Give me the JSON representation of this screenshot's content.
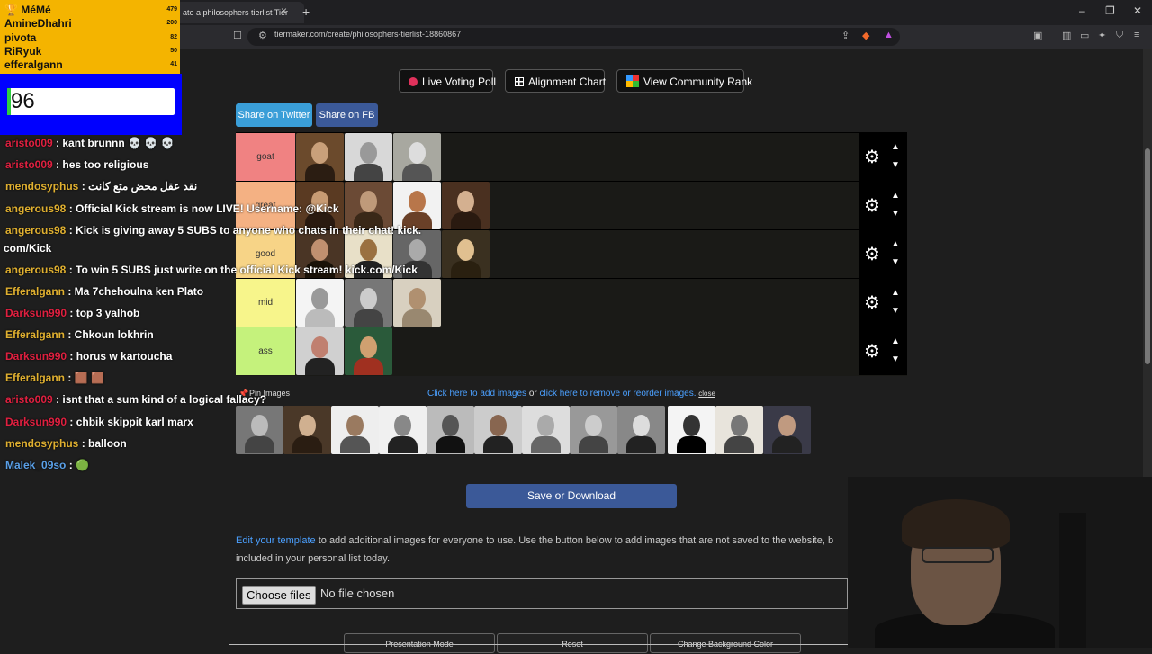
{
  "browser": {
    "tab_title": "ate a philosophers tierlist Tier",
    "tab_close": "×",
    "new_tab": "+",
    "url": "tiermaker.com/create/philosophers-tierlist-18860867",
    "window_controls": [
      "–",
      "❐",
      "✕"
    ]
  },
  "top_buttons": [
    {
      "label": "Live Voting Poll",
      "icon": "record-dot-icon"
    },
    {
      "label": "Alignment Chart",
      "icon": "grid-icon"
    },
    {
      "label": "View Community Rank",
      "icon": "mosaic-icon"
    }
  ],
  "share": {
    "twitter": "Share on Twitter",
    "fb": "Share on FB"
  },
  "tiers": [
    {
      "label": "goat",
      "color": "#f08282",
      "count": 3
    },
    {
      "label": "great",
      "color": "#f4b183",
      "count": 4
    },
    {
      "label": "good",
      "color": "#f7d487",
      "count": 4
    },
    {
      "label": "mid",
      "color": "#f7f58b",
      "count": 3
    },
    {
      "label": "ass",
      "color": "#c5f27c",
      "count": 2
    }
  ],
  "pin_images": "Pin Images",
  "image_links": {
    "add": "Click here to add images",
    "or": "or",
    "remove": "click here to remove or reorder images.",
    "close": "close"
  },
  "pool_count": 12,
  "save_button": "Save or Download",
  "help": {
    "link": "Edit your template",
    "text": " to add additional images for everyone to use. Use the button below to add images that are not saved to the website, b",
    "line2": "included in your personal list today."
  },
  "file_input": {
    "button": "Choose files",
    "status": "No file chosen"
  },
  "bottom_buttons": [
    "Presentation Mode",
    "Reset",
    "Change Background Color"
  ],
  "leaderboard": [
    {
      "name": "🏆 MéMé",
      "score": "479"
    },
    {
      "name": "AmineDhahri",
      "score": "200"
    },
    {
      "name": "pivota",
      "score": "82"
    },
    {
      "name": "RiRyuk",
      "score": "50"
    },
    {
      "name": "efferalgann",
      "score": "41"
    }
  ],
  "counter_value": "96",
  "chat": [
    {
      "user": "aristo009",
      "color": "#e02040",
      "msg": " : kant brunnn 💀 💀 💀"
    },
    {
      "user": "aristo009",
      "color": "#e02040",
      "msg": " : hes too religious"
    },
    {
      "user": "mendosyphus",
      "color": "#e0b030",
      "msg": " : نقد عقل محض متع كانت"
    },
    {
      "user": "angerous98",
      "color": "#e0b030",
      "msg": " : Official Kick stream is now LIVE! Username: @Kick"
    },
    {
      "user": "angerous98",
      "color": "#e0b030",
      "msg": " : Kick is giving away 5 SUBS to anyone who chats in their chat! kick."
    },
    {
      "user": "",
      "color": "#fff",
      "msg": "com/Kick"
    },
    {
      "user": "angerous98",
      "color": "#e0b030",
      "msg": " : To win 5 SUBS just write on the official Kick stream! kick.com/Kick"
    },
    {
      "user": "Efferalgann",
      "color": "#e0b030",
      "msg": " : Ma 7chehoulna ken Plato"
    },
    {
      "user": "Darksun990",
      "color": "#e02040",
      "msg": " : top 3 yalhob"
    },
    {
      "user": "Efferalgann",
      "color": "#e0b030",
      "msg": " : Chkoun lokhrin"
    },
    {
      "user": "Darksun990",
      "color": "#e02040",
      "msg": " : horus w kartoucha"
    },
    {
      "user": "Efferalgann",
      "color": "#e0b030",
      "msg": " : 🟫 🟫"
    },
    {
      "user": "aristo009",
      "color": "#e02040",
      "msg": " : isnt that a sum kind of a logical fallacy?"
    },
    {
      "user": "Darksun990",
      "color": "#e02040",
      "msg": " : chbik skippit karl marx"
    },
    {
      "user": "mendosyphus",
      "color": "#e0b030",
      "msg": " : balloon"
    },
    {
      "user": "Malek_09so",
      "color": "#5aa0e8",
      "msg": " : 🟢"
    }
  ]
}
